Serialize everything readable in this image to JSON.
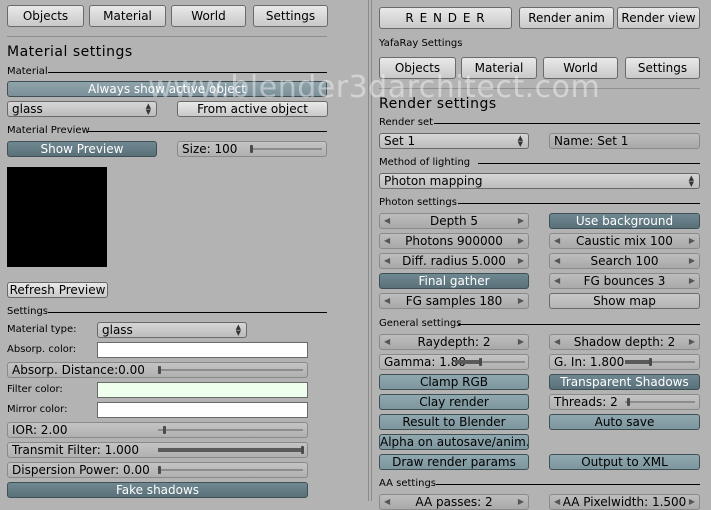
{
  "left_panel": {
    "tabs": [
      "Objects",
      "Material",
      "World",
      "Settings"
    ],
    "title": "Material settings",
    "material_section": "Material",
    "always_show_active": "Always show active object",
    "material_name": "glass",
    "from_active": "From active object",
    "preview_section": "Material Preview",
    "show_preview": "Show Preview",
    "size": "Size: 100",
    "size_fraction": 0.0,
    "refresh_preview": "Refresh Preview",
    "settings_section": "Settings",
    "material_type_label": "Material type:",
    "material_type": "glass",
    "absorp_color_label": "Absorp. color:",
    "absorp_distance": "Absorp. Distance:0.00",
    "filter_color_label": "Filter color:",
    "mirror_color_label": "Mirror color:",
    "ior": "IOR: 2.00",
    "transmit_filter": "Transmit Filter: 1.000",
    "dispersion_power": "Dispersion Power: 0.00",
    "fake_shadows": "Fake shadows",
    "colors": {
      "absorp": "#ffffff",
      "filter": "#eeffee",
      "mirror": "#ffffff",
      "preview": "#000000"
    }
  },
  "right_panel": {
    "render": "R E N D E R",
    "render_anim": "Render anim",
    "render_view": "Render view",
    "yafaray_settings": "YafaRay Settings",
    "tabs": [
      "Objects",
      "Material",
      "World",
      "Settings"
    ],
    "title": "Render settings",
    "render_set_section": "Render set",
    "render_set": "Set 1",
    "set_name": "Name: Set 1",
    "lighting_section": "Method of lighting",
    "lighting_method": "Photon mapping",
    "photon_section": "Photon settings",
    "depth": "Depth 5",
    "use_background": "Use background",
    "photons": "Photons 900000",
    "caustic_mix": "Caustic mix 100",
    "diff_radius": "Diff. radius 5.000",
    "search": "Search 100",
    "final_gather": "Final gather",
    "fg_bounces": "FG bounces 3",
    "fg_samples": "FG samples 180",
    "show_map": "Show map",
    "general_section": "General settings",
    "raydepth": "Raydepth: 2",
    "shadow_depth": "Shadow depth: 2",
    "gamma": "Gamma: 1.80",
    "g_in": "G. In: 1.800",
    "clamp_rgb": "Clamp RGB",
    "transparent_shadows": "Transparent Shadows",
    "clay_render": "Clay render",
    "threads": "Threads: 2",
    "result_to_blender": "Result to Blender",
    "auto_save": "Auto save",
    "alpha_autosave": "Alpha on autosave/anim.",
    "draw_render_params": "Draw render params",
    "output_to_xml": "Output to XML",
    "aa_section": "AA settings",
    "aa_passes": "AA passes: 2",
    "aa_pixelwidth": "AA Pixelwidth: 1.500"
  },
  "watermark": "www.blender3darchitect.com"
}
